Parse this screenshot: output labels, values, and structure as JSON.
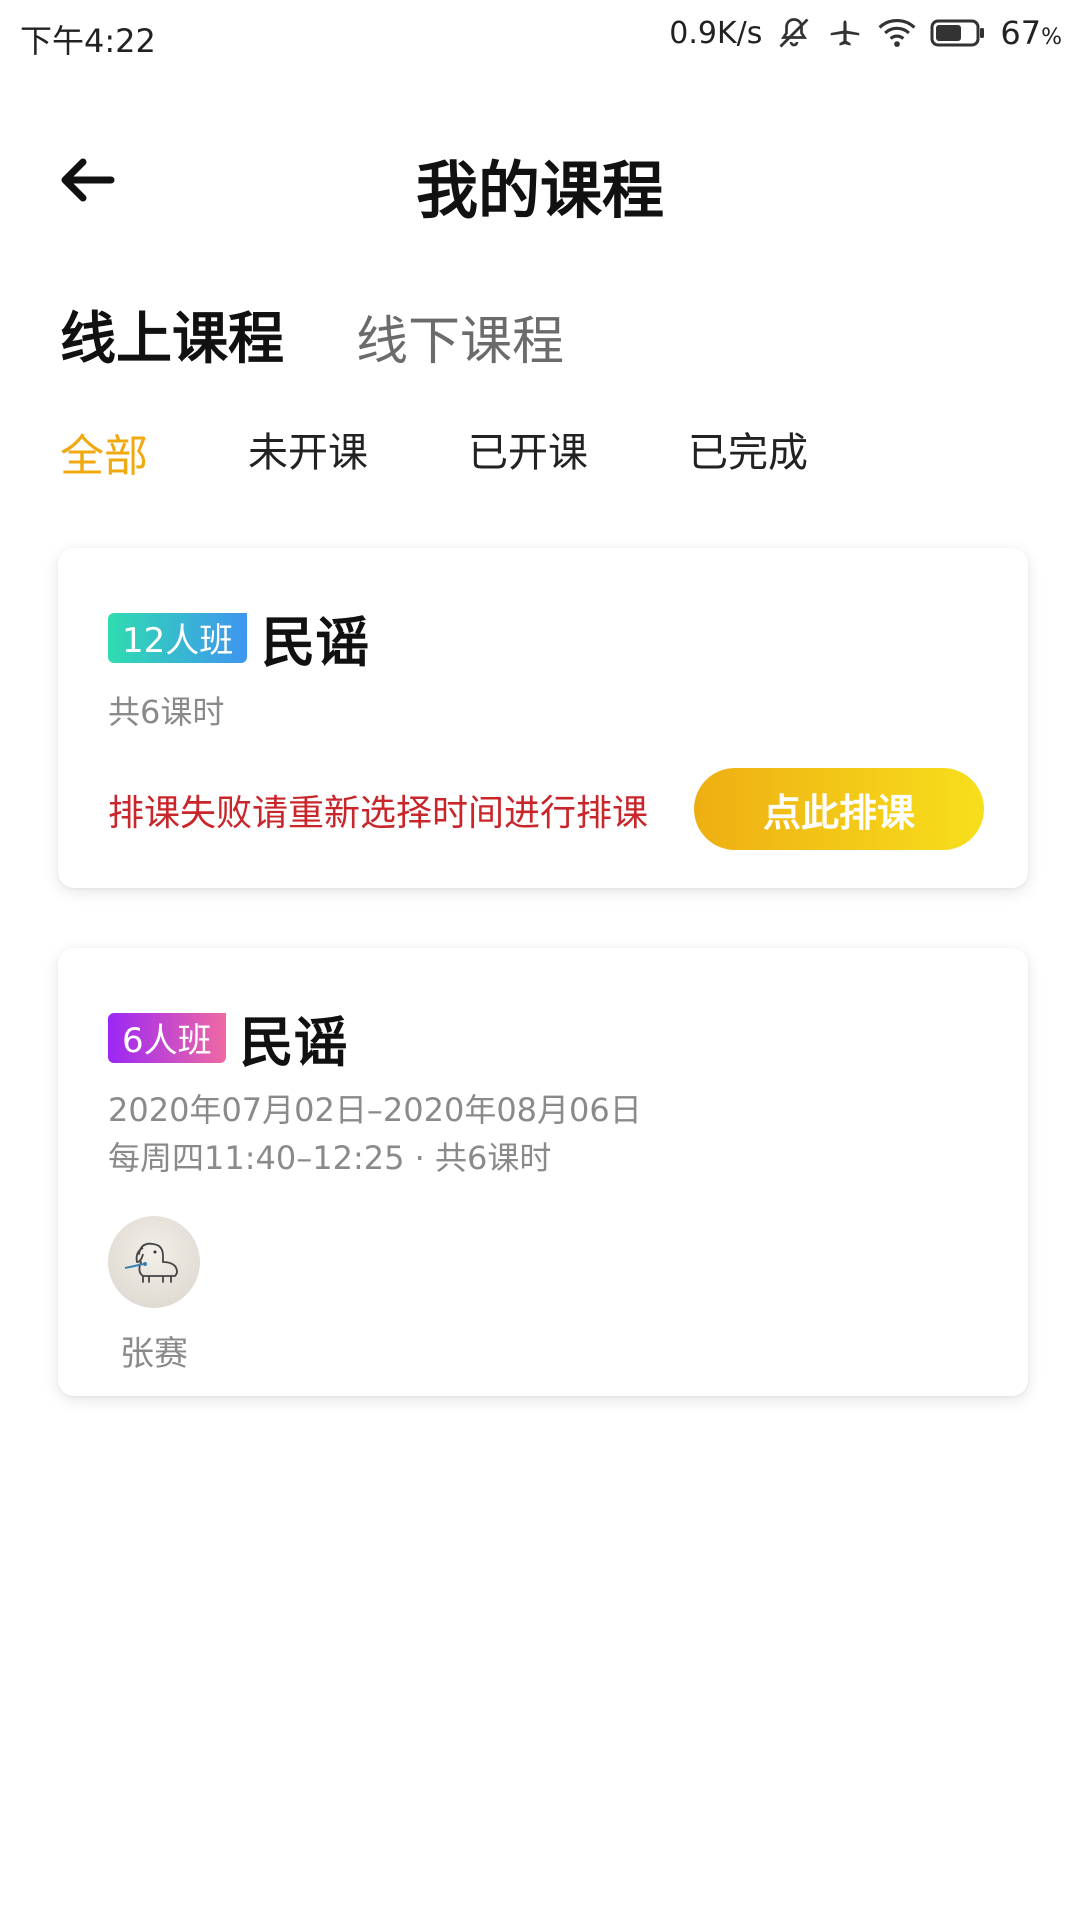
{
  "status_bar": {
    "time": "下午4:22",
    "network_speed": "0.9K/s",
    "battery_percent": "67",
    "battery_unit": "%",
    "battery_level": 0.67
  },
  "header": {
    "title": "我的课程"
  },
  "main_tabs": [
    {
      "label": "线上课程",
      "active": true
    },
    {
      "label": "线下课程",
      "active": false
    }
  ],
  "filter_tabs": [
    {
      "label": "全部",
      "active": true
    },
    {
      "label": "未开课",
      "active": false
    },
    {
      "label": "已开课",
      "active": false
    },
    {
      "label": "已完成",
      "active": false
    }
  ],
  "courses": [
    {
      "class_badge": "12人班",
      "name": "民谣",
      "hours": "共6课时",
      "error": "排课失败请重新选择时间进行排课",
      "button": "点此排课"
    },
    {
      "class_badge": "6人班",
      "name": "民谣",
      "date_range": "2020年07月02日–2020年08月06日",
      "schedule": "每周四11:40–12:25 · 共6课时",
      "teacher": "张赛"
    }
  ],
  "colors": {
    "accent": "#f0a90e",
    "error": "#c8262a",
    "tab_highlight": "#f9d77b"
  }
}
